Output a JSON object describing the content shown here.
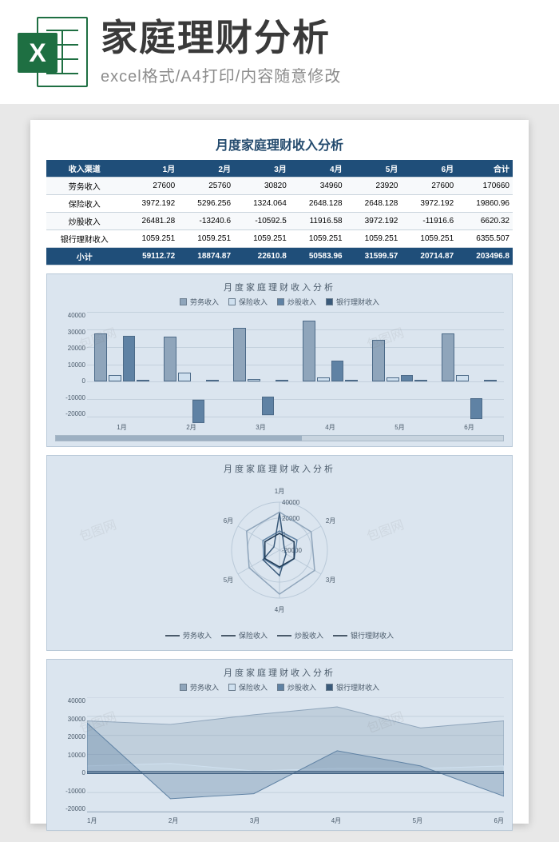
{
  "banner": {
    "title": "家庭理财分析",
    "subtitle": "excel格式/A4打印/内容随意修改",
    "iconLetter": "X"
  },
  "document": {
    "title": "月度家庭理财收入分析",
    "watermark": "包图网"
  },
  "table": {
    "headers": [
      "收入渠道",
      "1月",
      "2月",
      "3月",
      "4月",
      "5月",
      "6月",
      "合计"
    ],
    "rows": [
      {
        "label": "劳务收入",
        "values": [
          "27600",
          "25760",
          "30820",
          "34960",
          "23920",
          "27600",
          "170660"
        ]
      },
      {
        "label": "保险收入",
        "values": [
          "3972.192",
          "5296.256",
          "1324.064",
          "2648.128",
          "2648.128",
          "3972.192",
          "19860.96"
        ]
      },
      {
        "label": "炒股收入",
        "values": [
          "26481.28",
          "-13240.6",
          "-10592.5",
          "11916.58",
          "3972.192",
          "-11916.6",
          "6620.32"
        ]
      },
      {
        "label": "银行理财收入",
        "values": [
          "1059.251",
          "1059.251",
          "1059.251",
          "1059.251",
          "1059.251",
          "1059.251",
          "6355.507"
        ]
      }
    ],
    "footer": {
      "label": "小计",
      "values": [
        "59112.72",
        "18874.87",
        "22610.8",
        "50583.96",
        "31599.57",
        "20714.87",
        "203496.8"
      ]
    }
  },
  "chart_data": [
    {
      "type": "bar",
      "title": "月度家庭理财收入分析",
      "categories": [
        "1月",
        "2月",
        "3月",
        "4月",
        "5月",
        "6月"
      ],
      "series": [
        {
          "name": "劳务收入",
          "values": [
            27600,
            25760,
            30820,
            34960,
            23920,
            27600
          ]
        },
        {
          "name": "保险收入",
          "values": [
            3972.192,
            5296.256,
            1324.064,
            2648.128,
            2648.128,
            3972.192
          ]
        },
        {
          "name": "炒股收入",
          "values": [
            26481.28,
            -13240.6,
            -10592.5,
            11916.58,
            3972.192,
            -11916.6
          ]
        },
        {
          "name": "银行理财收入",
          "values": [
            1059.251,
            1059.251,
            1059.251,
            1059.251,
            1059.251,
            1059.251
          ]
        }
      ],
      "ylim": [
        -20000,
        40000
      ],
      "yticks": [
        -20000,
        -10000,
        0,
        10000,
        20000,
        30000,
        40000
      ],
      "xlabel": "",
      "ylabel": ""
    },
    {
      "type": "radar",
      "title": "月度家庭理财收入分析",
      "categories": [
        "1月",
        "2月",
        "3月",
        "4月",
        "5月",
        "6月"
      ],
      "series": [
        {
          "name": "劳务收入",
          "values": [
            27600,
            25760,
            30820,
            34960,
            23920,
            27600
          ]
        },
        {
          "name": "保险收入",
          "values": [
            3972.192,
            5296.256,
            1324.064,
            2648.128,
            2648.128,
            3972.192
          ]
        },
        {
          "name": "炒股收入",
          "values": [
            26481.28,
            -13240.6,
            -10592.5,
            11916.58,
            3972.192,
            -11916.6
          ]
        },
        {
          "name": "银行理财收入",
          "values": [
            1059.251,
            1059.251,
            1059.251,
            1059.251,
            1059.251,
            1059.251
          ]
        }
      ],
      "rlim": [
        -20000,
        40000
      ],
      "rticks": [
        -20000,
        0,
        20000,
        40000
      ]
    },
    {
      "type": "area",
      "title": "月度家庭理财收入分析",
      "categories": [
        "1月",
        "2月",
        "3月",
        "4月",
        "5月",
        "6月"
      ],
      "series": [
        {
          "name": "劳务收入",
          "values": [
            27600,
            25760,
            30820,
            34960,
            23920,
            27600
          ]
        },
        {
          "name": "保险收入",
          "values": [
            3972.192,
            5296.256,
            1324.064,
            2648.128,
            2648.128,
            3972.192
          ]
        },
        {
          "name": "炒股收入",
          "values": [
            26481.28,
            -13240.6,
            -10592.5,
            11916.58,
            3972.192,
            -11916.6
          ]
        },
        {
          "name": "银行理财收入",
          "values": [
            1059.251,
            1059.251,
            1059.251,
            1059.251,
            1059.251,
            1059.251
          ]
        }
      ],
      "ylim": [
        -20000,
        40000
      ],
      "yticks": [
        -20000,
        -10000,
        0,
        10000,
        20000,
        30000,
        40000
      ],
      "xlabel": "",
      "ylabel": ""
    }
  ],
  "colors": {
    "series": [
      "#8fa5bb",
      "#cfe0ef",
      "#5f82a4",
      "#3a5a7a"
    ],
    "headerBg": "#1f4e79"
  }
}
